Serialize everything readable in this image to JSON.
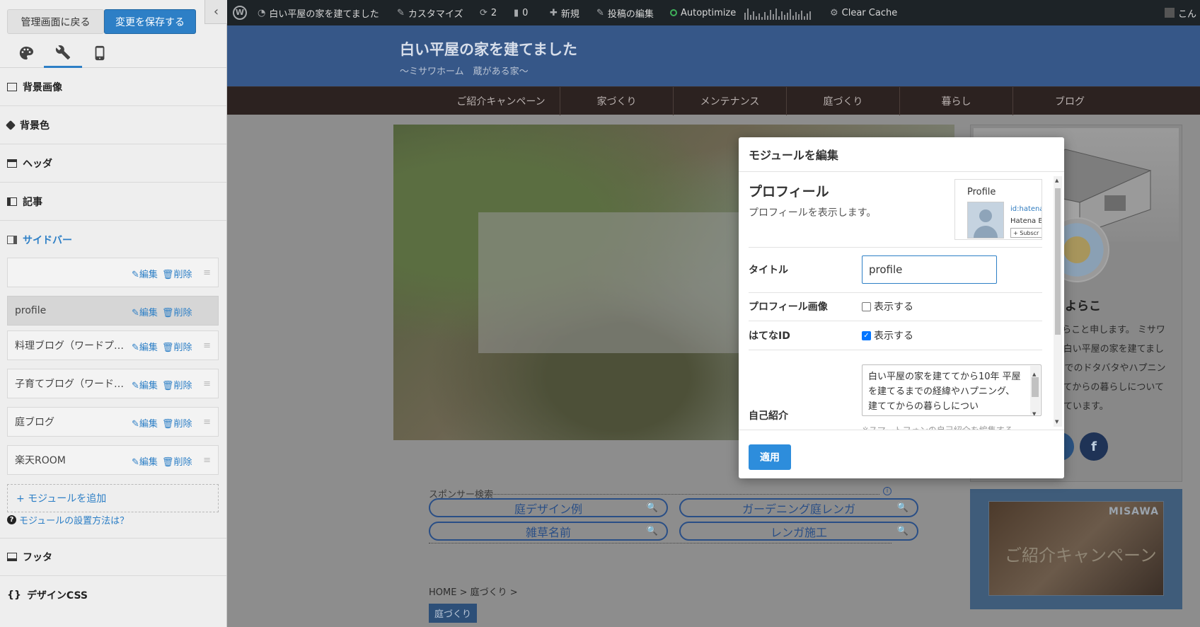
{
  "customizer": {
    "back_label": "管理画面に戻る",
    "save_label": "変更を保存する",
    "collapse_glyph": "‹",
    "sections": {
      "bg_image": "背景画像",
      "bg_color": "背景色",
      "header": "ヘッダ",
      "article": "記事",
      "sidebar": "サイドバー",
      "footer": "フッタ",
      "design_css": "デザインCSS"
    },
    "modules": [
      {
        "name": ""
      },
      {
        "name": "profile"
      },
      {
        "name": "料理ブログ（ワードプ…"
      },
      {
        "name": "子育てブログ（ワード…"
      },
      {
        "name": "庭ブログ"
      },
      {
        "name": "楽天ROOM"
      }
    ],
    "edit_label": "編集",
    "delete_label": "削除",
    "add_module_label": "+ モジュールを追加",
    "help_label": "モジュールの設置方法は？",
    "css_glyph": "{}"
  },
  "adminbar": {
    "site_name": "白い平屋の家を建てました",
    "customize": "カスタマイズ",
    "updates": "2",
    "comments": "0",
    "new": "新規",
    "edit_post": "投稿の編集",
    "autoptimize": "Autoptimize",
    "clear_cache": "Clear Cache",
    "user": "こん"
  },
  "site": {
    "title": "白い平屋の家を建てました",
    "description": "〜ミサワホーム　蔵がある家〜",
    "nav": [
      "ご紹介キャンペーン",
      "家づくり",
      "メンテナンス",
      "庭づくり",
      "暮らし",
      "ブログ"
    ],
    "profile_name": "たよらこ",
    "profile_bio": "こんにちは、たよらこと申します。 ミサワホームで蔵のある白い平屋の家を建てました。 家を建てるまでのドタバタやハプニングの記録と、建ててからの暮らしについて書いています。",
    "promo_brand": "MISAWA",
    "promo_title": "ご紹介キャンペーン",
    "sponsor_label": "スポンサー検索",
    "sponsor_info": "i",
    "sponsor_links": [
      "庭デザイン例",
      "ガーデニング庭レンガ",
      "雑草名前",
      "レンガ施工"
    ],
    "breadcrumb": "HOME > 庭づくり >",
    "category_tag": "庭づくり"
  },
  "modal": {
    "header": "モジュールを編集",
    "module_title": "プロフィール",
    "module_desc": "プロフィールを表示します。",
    "preview": {
      "label": "Profile",
      "id_text": "id:hatena",
      "name_text": "Hatena B",
      "subscribe": "+ Subscr"
    },
    "field_title_label": "タイトル",
    "field_title_value": "profile",
    "field_image_label": "プロフィール画像",
    "field_image_check": "表示する",
    "field_id_label": "はてなID",
    "field_id_check": "表示する",
    "field_bio_label": "自己紹介",
    "field_bio_value": "白い平屋の家を建ててから10年 平屋を建てるまでの経緯やハプニング、建ててからの暮らしについ",
    "overflow_text": "※スマートフォンの自己紹介を編集する",
    "apply_label": "適用"
  }
}
